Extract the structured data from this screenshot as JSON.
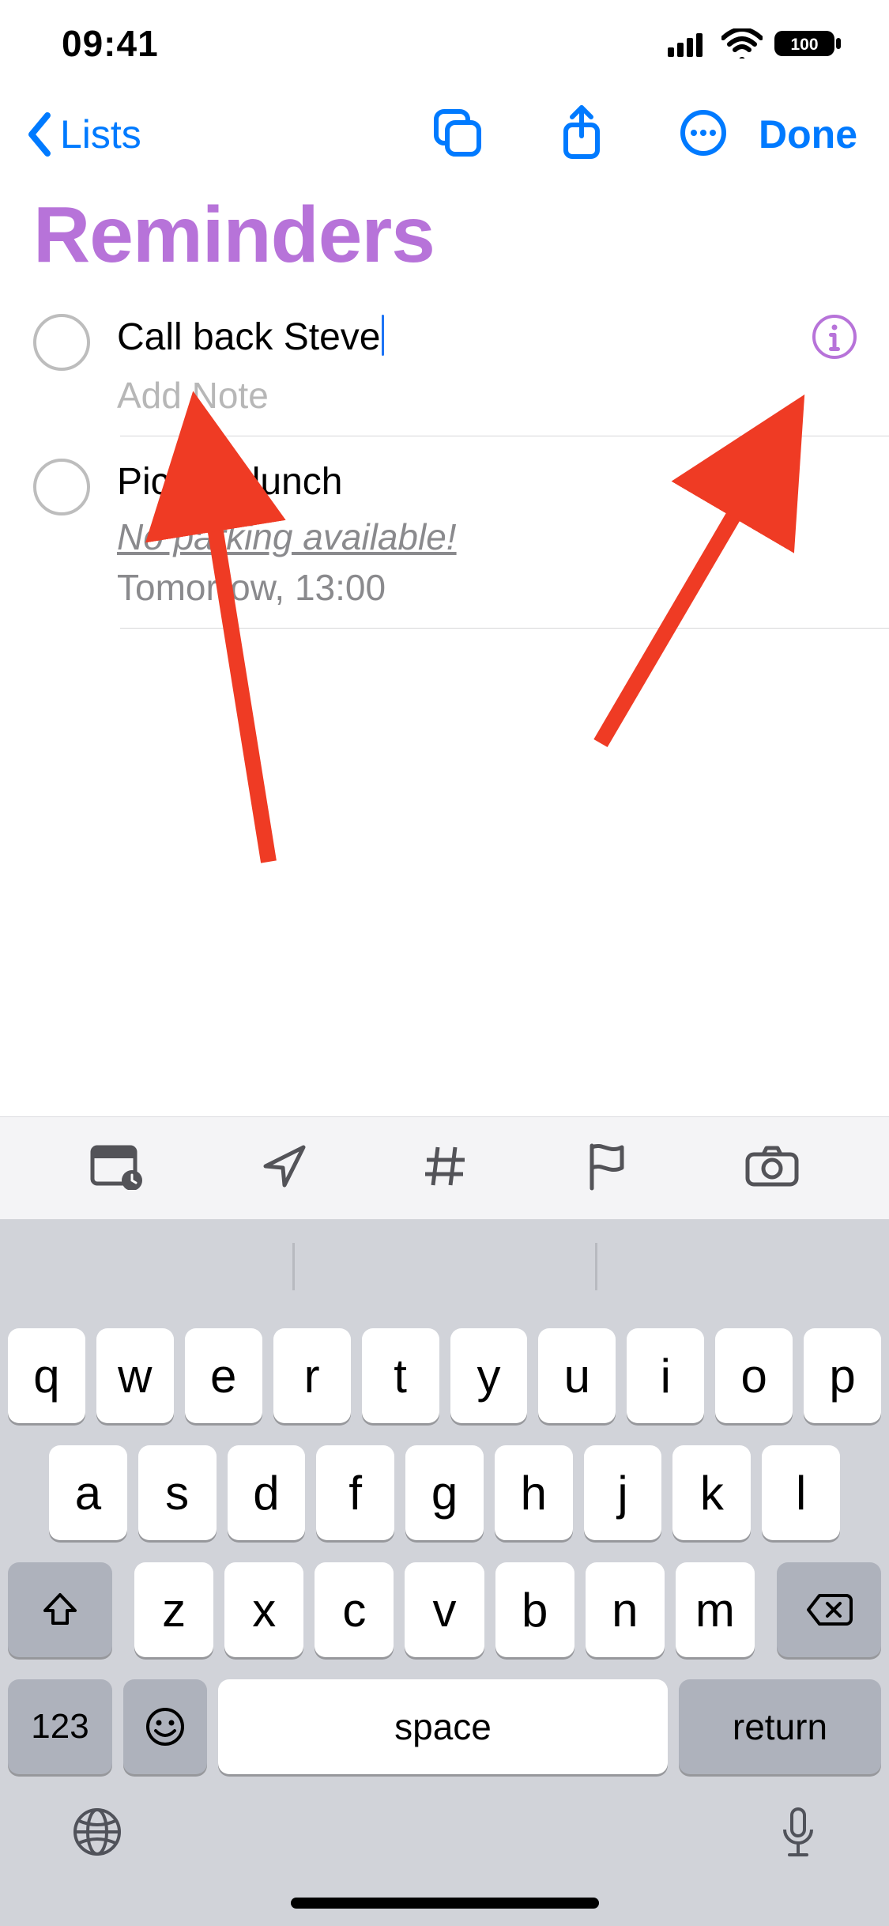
{
  "status": {
    "time": "09:41",
    "battery": "100"
  },
  "nav": {
    "back_label": "Lists",
    "done_label": "Done"
  },
  "page_title": "Reminders",
  "reminders": [
    {
      "title": "Call back Steve",
      "note_placeholder": "Add Note",
      "editing": true
    },
    {
      "title": "Pick up lunch",
      "note": "No parking available!",
      "due": "Tomorrow, 13:00"
    }
  ],
  "keyboard": {
    "row1": [
      "q",
      "w",
      "e",
      "r",
      "t",
      "y",
      "u",
      "i",
      "o",
      "p"
    ],
    "row2": [
      "a",
      "s",
      "d",
      "f",
      "g",
      "h",
      "j",
      "k",
      "l"
    ],
    "row3": [
      "z",
      "x",
      "c",
      "v",
      "b",
      "n",
      "m"
    ],
    "numbers_label": "123",
    "space_label": "space",
    "return_label": "return"
  }
}
